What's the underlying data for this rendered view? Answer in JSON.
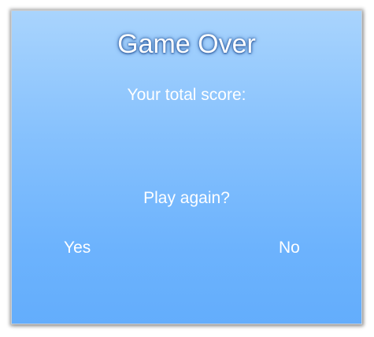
{
  "dialog": {
    "title": "Game Over",
    "score_label": "Your total score:",
    "score_value": "",
    "prompt": "Play again?",
    "yes_label": "Yes",
    "no_label": "No"
  },
  "colors": {
    "panel_top": "#a9d4fd",
    "panel_bottom": "#63adfc",
    "text": "#ffffff"
  }
}
